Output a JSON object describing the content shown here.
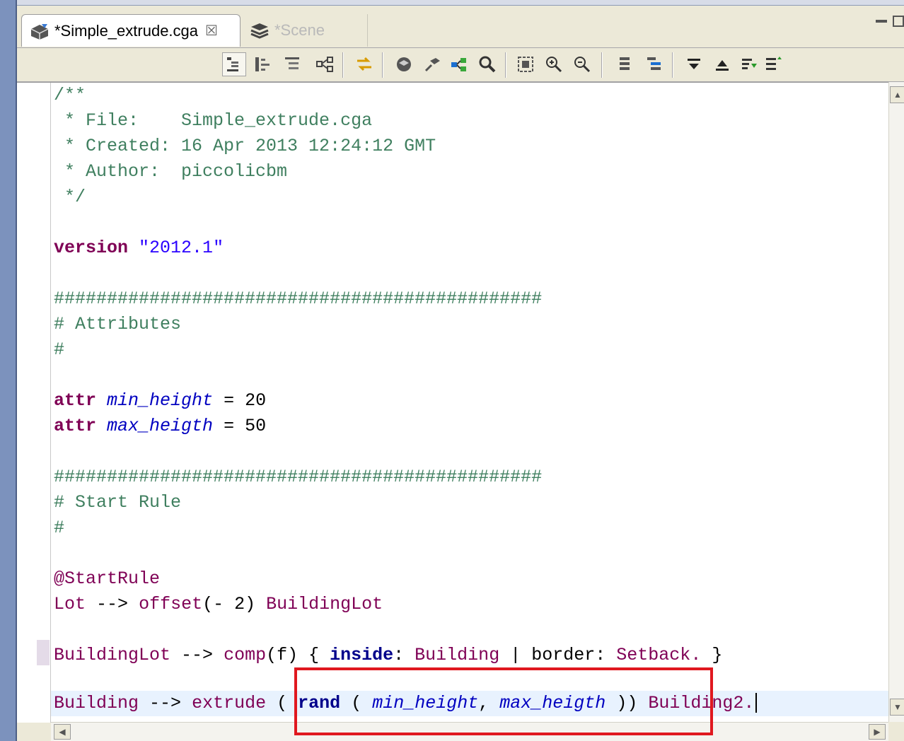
{
  "tabs": [
    {
      "label": "*Simple_extrude.cga",
      "active": true,
      "icon": "cga-file-icon",
      "close": "☒"
    },
    {
      "label": "*Scene",
      "active": false,
      "icon": "layers-icon"
    }
  ],
  "toolbar": {
    "icons": [
      "outline-tree-icon",
      "hierarchy-icon",
      "tree-expand-icon",
      "graph-icon",
      "sync-icon",
      "model-icon",
      "generate-icon",
      "connect-icon",
      "search-icon",
      "frame-icon",
      "zoom-in-icon",
      "zoom-out-icon",
      "list-icon",
      "outline-icon",
      "collapse-down-icon",
      "collapse-up-icon",
      "filter-icon",
      "sort-icon"
    ]
  },
  "code": {
    "line1": "/**",
    "line2": " * File:    Simple_extrude.cga",
    "line3": " * Created: 16 Apr 2013 12:24:12 GMT",
    "line4": " * Author:  piccolicbm",
    "line5": " */",
    "version_kw": "version",
    "version_val": "\"2012.1\"",
    "hashes": "##############################################",
    "attr_comment": "# Attributes",
    "hash_single": "#",
    "attr_kw": "attr",
    "min_name": "min_height",
    "min_val": "= 20",
    "max_name": "max_heigth",
    "max_val": "= 50",
    "start_comment": "# Start Rule",
    "annotation": "@StartRule",
    "lot_rule": "Lot",
    "arrow": "-->",
    "offset_func": "offset",
    "offset_args": "(- 2)",
    "building_lot": "BuildingLot",
    "comp_func": "comp",
    "comp_args": "(f) {",
    "inside_kw": "inside",
    "colon": ":",
    "building": "Building",
    "pipe": "|",
    "border_kw": "border",
    "setback": "Setback.",
    "close_brace": "}",
    "extrude_func": "extrude",
    "open_paren": "(",
    "rand_kw": "rand",
    "comma": ",",
    "close_parens": "))",
    "building2": "Building2."
  },
  "colors": {
    "comment": "#3f7f5f",
    "keyword": "#7f0055",
    "string": "#2a00ff",
    "attribute": "#0000c0",
    "annotation_box": "#e0181f",
    "current_line": "#e8f2fe"
  }
}
